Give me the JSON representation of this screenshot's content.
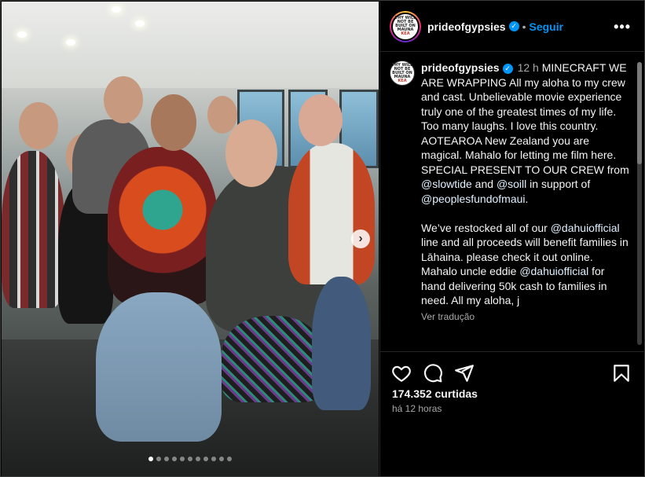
{
  "post": {
    "username": "prideofgypsies",
    "follow_label": "Seguir",
    "separator": "•",
    "more_label": "•••",
    "avatar_text": [
      "THY WILL",
      "NOT BE",
      "BUILT ON",
      "MAUNA",
      "KEA"
    ]
  },
  "caption": {
    "username": "prideofgypsies",
    "time": "12 h",
    "paragraph1": [
      {
        "t": "MINECRAFT WE ARE WRAPPING All my aloha to my crew and cast. Unbelievable movie experience truly one of the greatest times of my life. Too many laughs. I love this country. AOTEAROA New Zealand you are magical. Mahalo for letting me film here. SPECIAL PRESENT TO OUR CREW from ",
        "m": false
      },
      {
        "t": "@slowtide",
        "m": true
      },
      {
        "t": " and ",
        "m": false
      },
      {
        "t": "@soill",
        "m": true
      },
      {
        "t": " in support of ",
        "m": false
      },
      {
        "t": "@peoplesfundofmaui",
        "m": true
      },
      {
        "t": ".",
        "m": false
      }
    ],
    "paragraph2": [
      {
        "t": "We’ve restocked all of our ",
        "m": false
      },
      {
        "t": "@dahuiofficial",
        "m": true
      },
      {
        "t": " line and all proceeds will benefit families in Lāhaina. please check it out online.",
        "m": false
      }
    ],
    "paragraph3": [
      {
        "t": "Mahalo uncle eddie ",
        "m": false
      },
      {
        "t": "@dahuiofficial",
        "m": true
      },
      {
        "t": " for hand delivering 50k cash to families in need. All my aloha, j",
        "m": false
      }
    ],
    "translate_label": "Ver tradução"
  },
  "actions": {
    "like_icon": "heart-icon",
    "comment_icon": "comment-icon",
    "share_icon": "send-icon",
    "save_icon": "bookmark-icon"
  },
  "stats": {
    "likes": "174.352 curtidas",
    "posted": "há 12 horas"
  },
  "carousel": {
    "count": 11,
    "active_index": 0,
    "next_icon": "chevron-right-icon"
  },
  "colors": {
    "link": "#0095f6",
    "background": "#000000",
    "secondary_text": "#a8a8a8"
  }
}
